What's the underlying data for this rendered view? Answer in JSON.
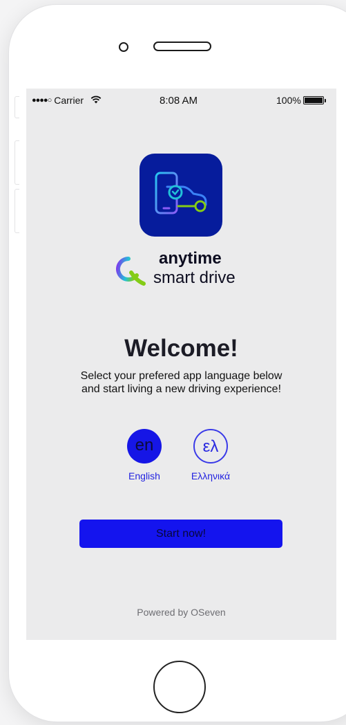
{
  "status_bar": {
    "signal": "●●●●○",
    "carrier": "Carrier",
    "wifi_glyph": "ᯤ",
    "time": "8:08 AM",
    "battery_percent": "100%",
    "battery_level": 1.0
  },
  "app_icon": {
    "name": "app-icon",
    "background": "#061c9c",
    "icon": "phone-car-icon"
  },
  "logo": {
    "word1": "anytime",
    "word2": "smart drive",
    "mark_colors": [
      "#7c3aed",
      "#22c1d8",
      "#84cc16"
    ]
  },
  "welcome": {
    "title": "Welcome!",
    "subtitle_line1": "Select your prefered app language below",
    "subtitle_line2": "and start living a new driving experience!"
  },
  "languages": [
    {
      "code": "en",
      "label": "English",
      "selected": true
    },
    {
      "code": "ελ",
      "label": "Ελληνικά",
      "selected": false
    }
  ],
  "start_button": {
    "label": "Start now!"
  },
  "footer": {
    "powered_by": "Powered by OSeven"
  },
  "colors": {
    "accent": "#1414ee",
    "screen_bg": "#ebebec",
    "icon_bg": "#061c9c"
  }
}
